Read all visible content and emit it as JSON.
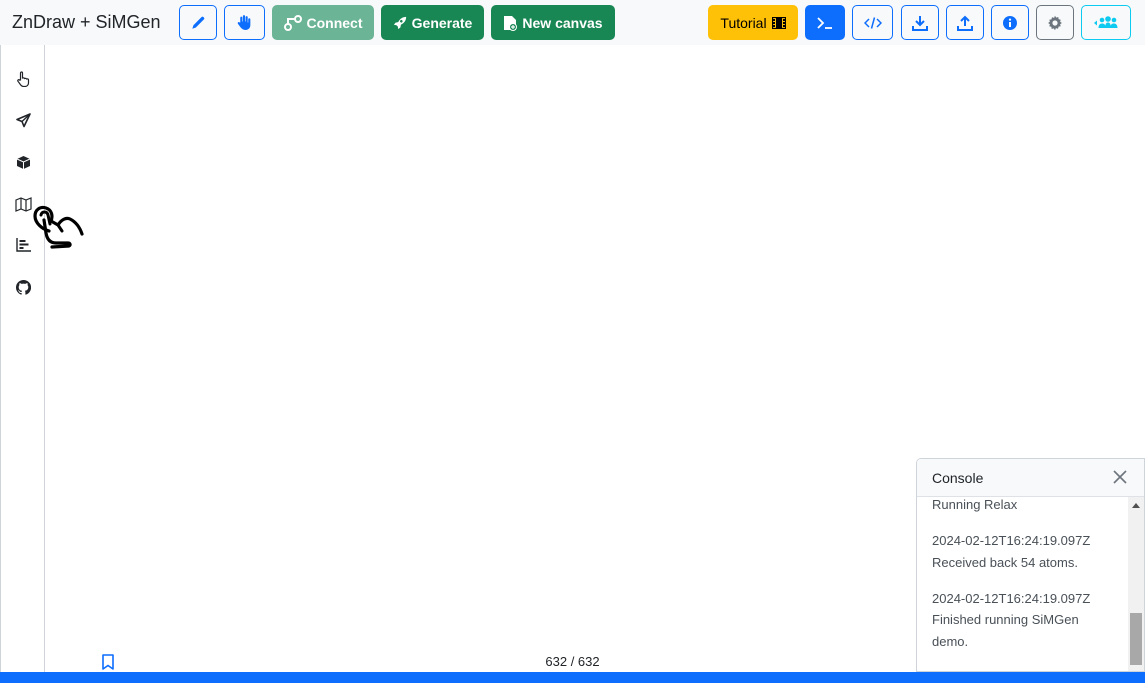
{
  "navbar": {
    "brand": "ZnDraw + SiMGen",
    "buttons": {
      "draw": {
        "icon": "pencil-icon"
      },
      "interact": {
        "icon": "hand-icon"
      },
      "connect": {
        "label": "Connect",
        "icon": "git-connect-icon"
      },
      "generate": {
        "label": "Generate",
        "icon": "rocket-icon"
      },
      "new_canvas": {
        "label": "New canvas",
        "icon": "file-plus-icon"
      },
      "tutorial": {
        "label": "Tutorial",
        "icon": "film-icon"
      },
      "terminal": {
        "icon": "terminal-icon"
      },
      "code": {
        "icon": "code-icon"
      },
      "download": {
        "icon": "download-icon"
      },
      "upload": {
        "icon": "upload-icon"
      },
      "info": {
        "icon": "info-icon"
      },
      "settings": {
        "icon": "gear-icon"
      },
      "users": {
        "icon": "users-icon"
      }
    }
  },
  "sidebar": {
    "items": [
      {
        "name": "selection",
        "icon": "pointer-hand-icon"
      },
      {
        "name": "geometry",
        "icon": "send-icon"
      },
      {
        "name": "modifier",
        "icon": "box-icon"
      },
      {
        "name": "scene",
        "icon": "map-icon"
      },
      {
        "name": "analysis",
        "icon": "bar-chart-icon"
      },
      {
        "name": "github",
        "icon": "github-icon"
      }
    ]
  },
  "console": {
    "title": "Console",
    "lines": [
      "Running Relax",
      "2024-02-12T16:24:19.097Z",
      "Received back 54 atoms.",
      "2024-02-12T16:24:19.097Z",
      "Finished running SiMGen",
      "demo."
    ]
  },
  "timeline": {
    "frame_counter": "632 / 632",
    "progress_fraction": 1.0
  },
  "colors": {
    "primary": "#0d6efd",
    "success": "#198754",
    "warning": "#ffc107",
    "info": "#0dcaf0",
    "secondary": "#6c757d"
  }
}
